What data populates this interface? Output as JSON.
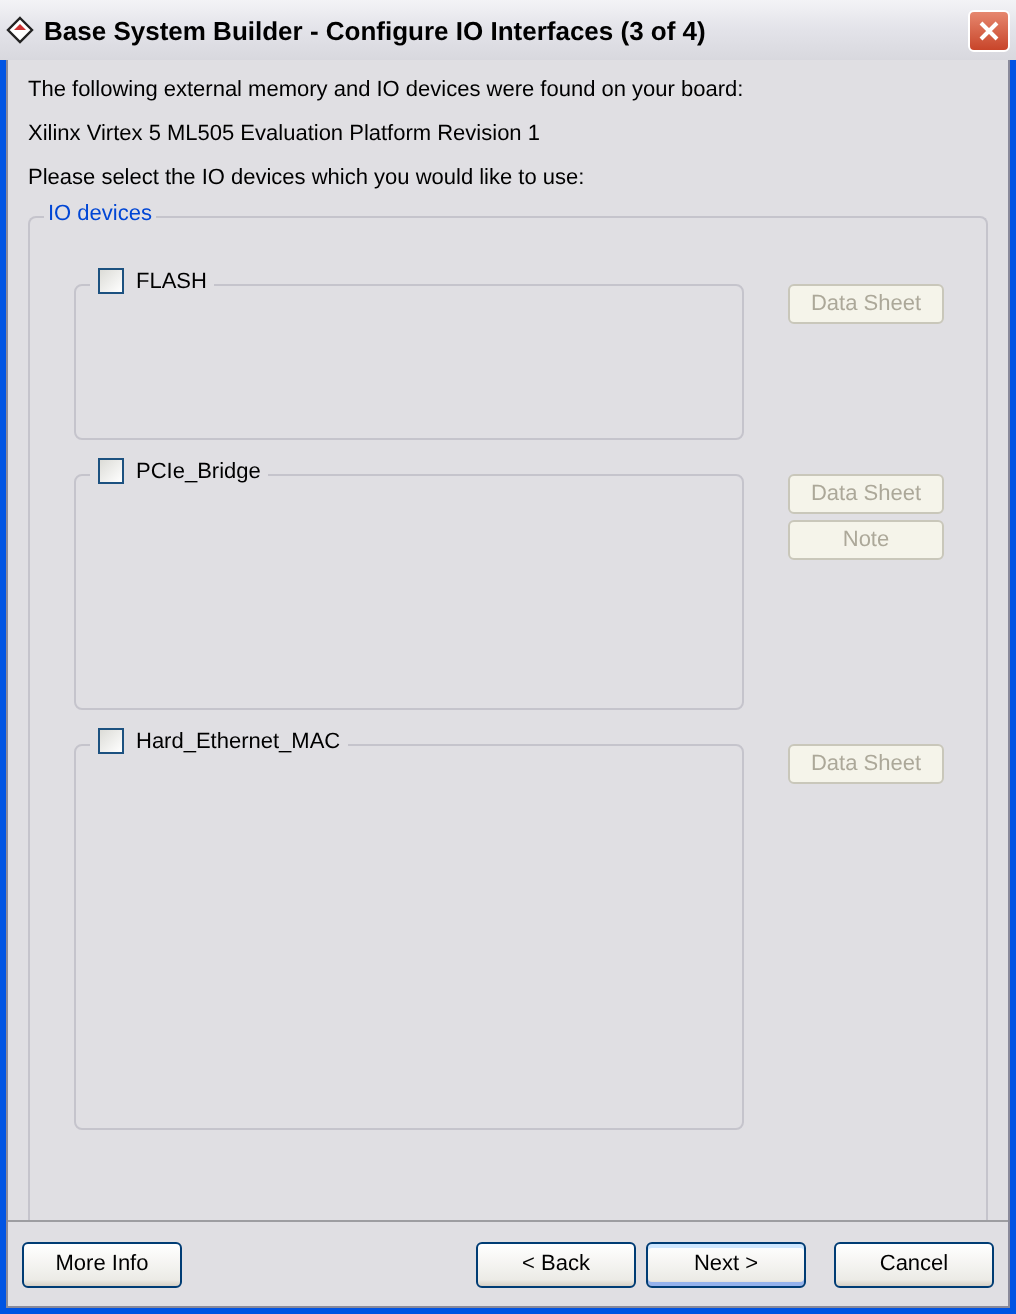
{
  "window": {
    "title": "Base System Builder - Configure IO Interfaces (3 of 4)"
  },
  "intro": [
    "The following external memory and IO devices were found on your board:",
    "Xilinx Virtex 5 ML505 Evaluation Platform Revision 1",
    "Please select the IO devices which you would like to use:"
  ],
  "group": {
    "title": "IO devices",
    "devices": [
      {
        "name": "FLASH",
        "checked": false,
        "buttons": [
          {
            "label": "Data Sheet",
            "disabled": true
          }
        ]
      },
      {
        "name": "PCIe_Bridge",
        "checked": false,
        "buttons": [
          {
            "label": "Data Sheet",
            "disabled": true
          },
          {
            "label": "Note",
            "disabled": true
          }
        ]
      },
      {
        "name": "Hard_Ethernet_MAC",
        "checked": false,
        "buttons": [
          {
            "label": "Data Sheet",
            "disabled": true
          }
        ]
      }
    ]
  },
  "footer": {
    "left": [
      {
        "label": "More Info",
        "default": false
      }
    ],
    "right": [
      {
        "label": "< Back",
        "default": false
      },
      {
        "label": "Next >",
        "default": true
      }
    ],
    "cancel": {
      "label": "Cancel",
      "default": false
    }
  }
}
